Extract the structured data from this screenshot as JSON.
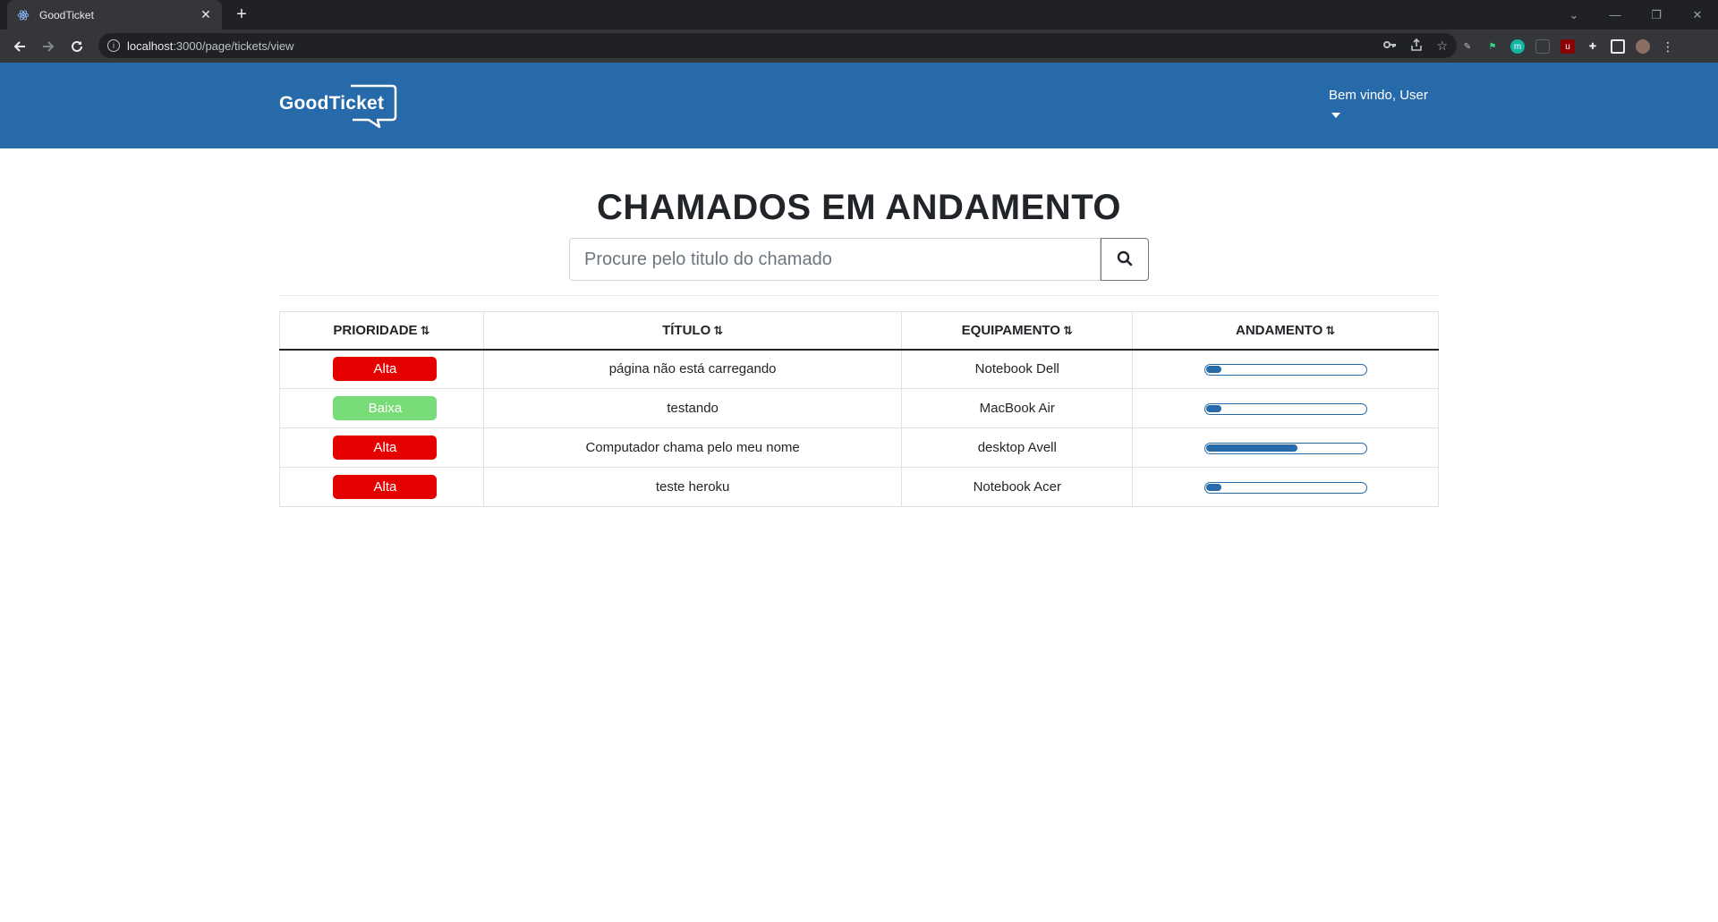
{
  "browser": {
    "tab_title": "GoodTicket",
    "url_host": "localhost",
    "url_path": ":3000/page/tickets/view"
  },
  "header": {
    "logo_text": "GoodTicket",
    "user_greeting": "Bem vindo, User"
  },
  "page": {
    "title": "CHAMADOS EM ANDAMENTO",
    "search_placeholder": "Procure pelo titulo do chamado"
  },
  "table": {
    "columns": [
      "PRIORIDADE",
      "TÍTULO",
      "EQUIPAMENTO",
      "ANDAMENTO"
    ],
    "rows": [
      {
        "priority": "Alta",
        "priority_color": "#e50000",
        "title": "página não está carregando",
        "equipment": "Notebook Dell",
        "progress": 0.1
      },
      {
        "priority": "Baixa",
        "priority_color": "#78dc78",
        "title": "testando",
        "equipment": "MacBook Air",
        "progress": 0.1
      },
      {
        "priority": "Alta",
        "priority_color": "#e50000",
        "title": "Computador chama pelo meu nome",
        "equipment": "desktop Avell",
        "progress": 0.58
      },
      {
        "priority": "Alta",
        "priority_color": "#e50000",
        "title": "teste heroku",
        "equipment": "Notebook Acer",
        "progress": 0.1
      }
    ]
  },
  "colors": {
    "header_bg": "#276aa9",
    "alta": "#e50000",
    "baixa": "#78dc78"
  }
}
